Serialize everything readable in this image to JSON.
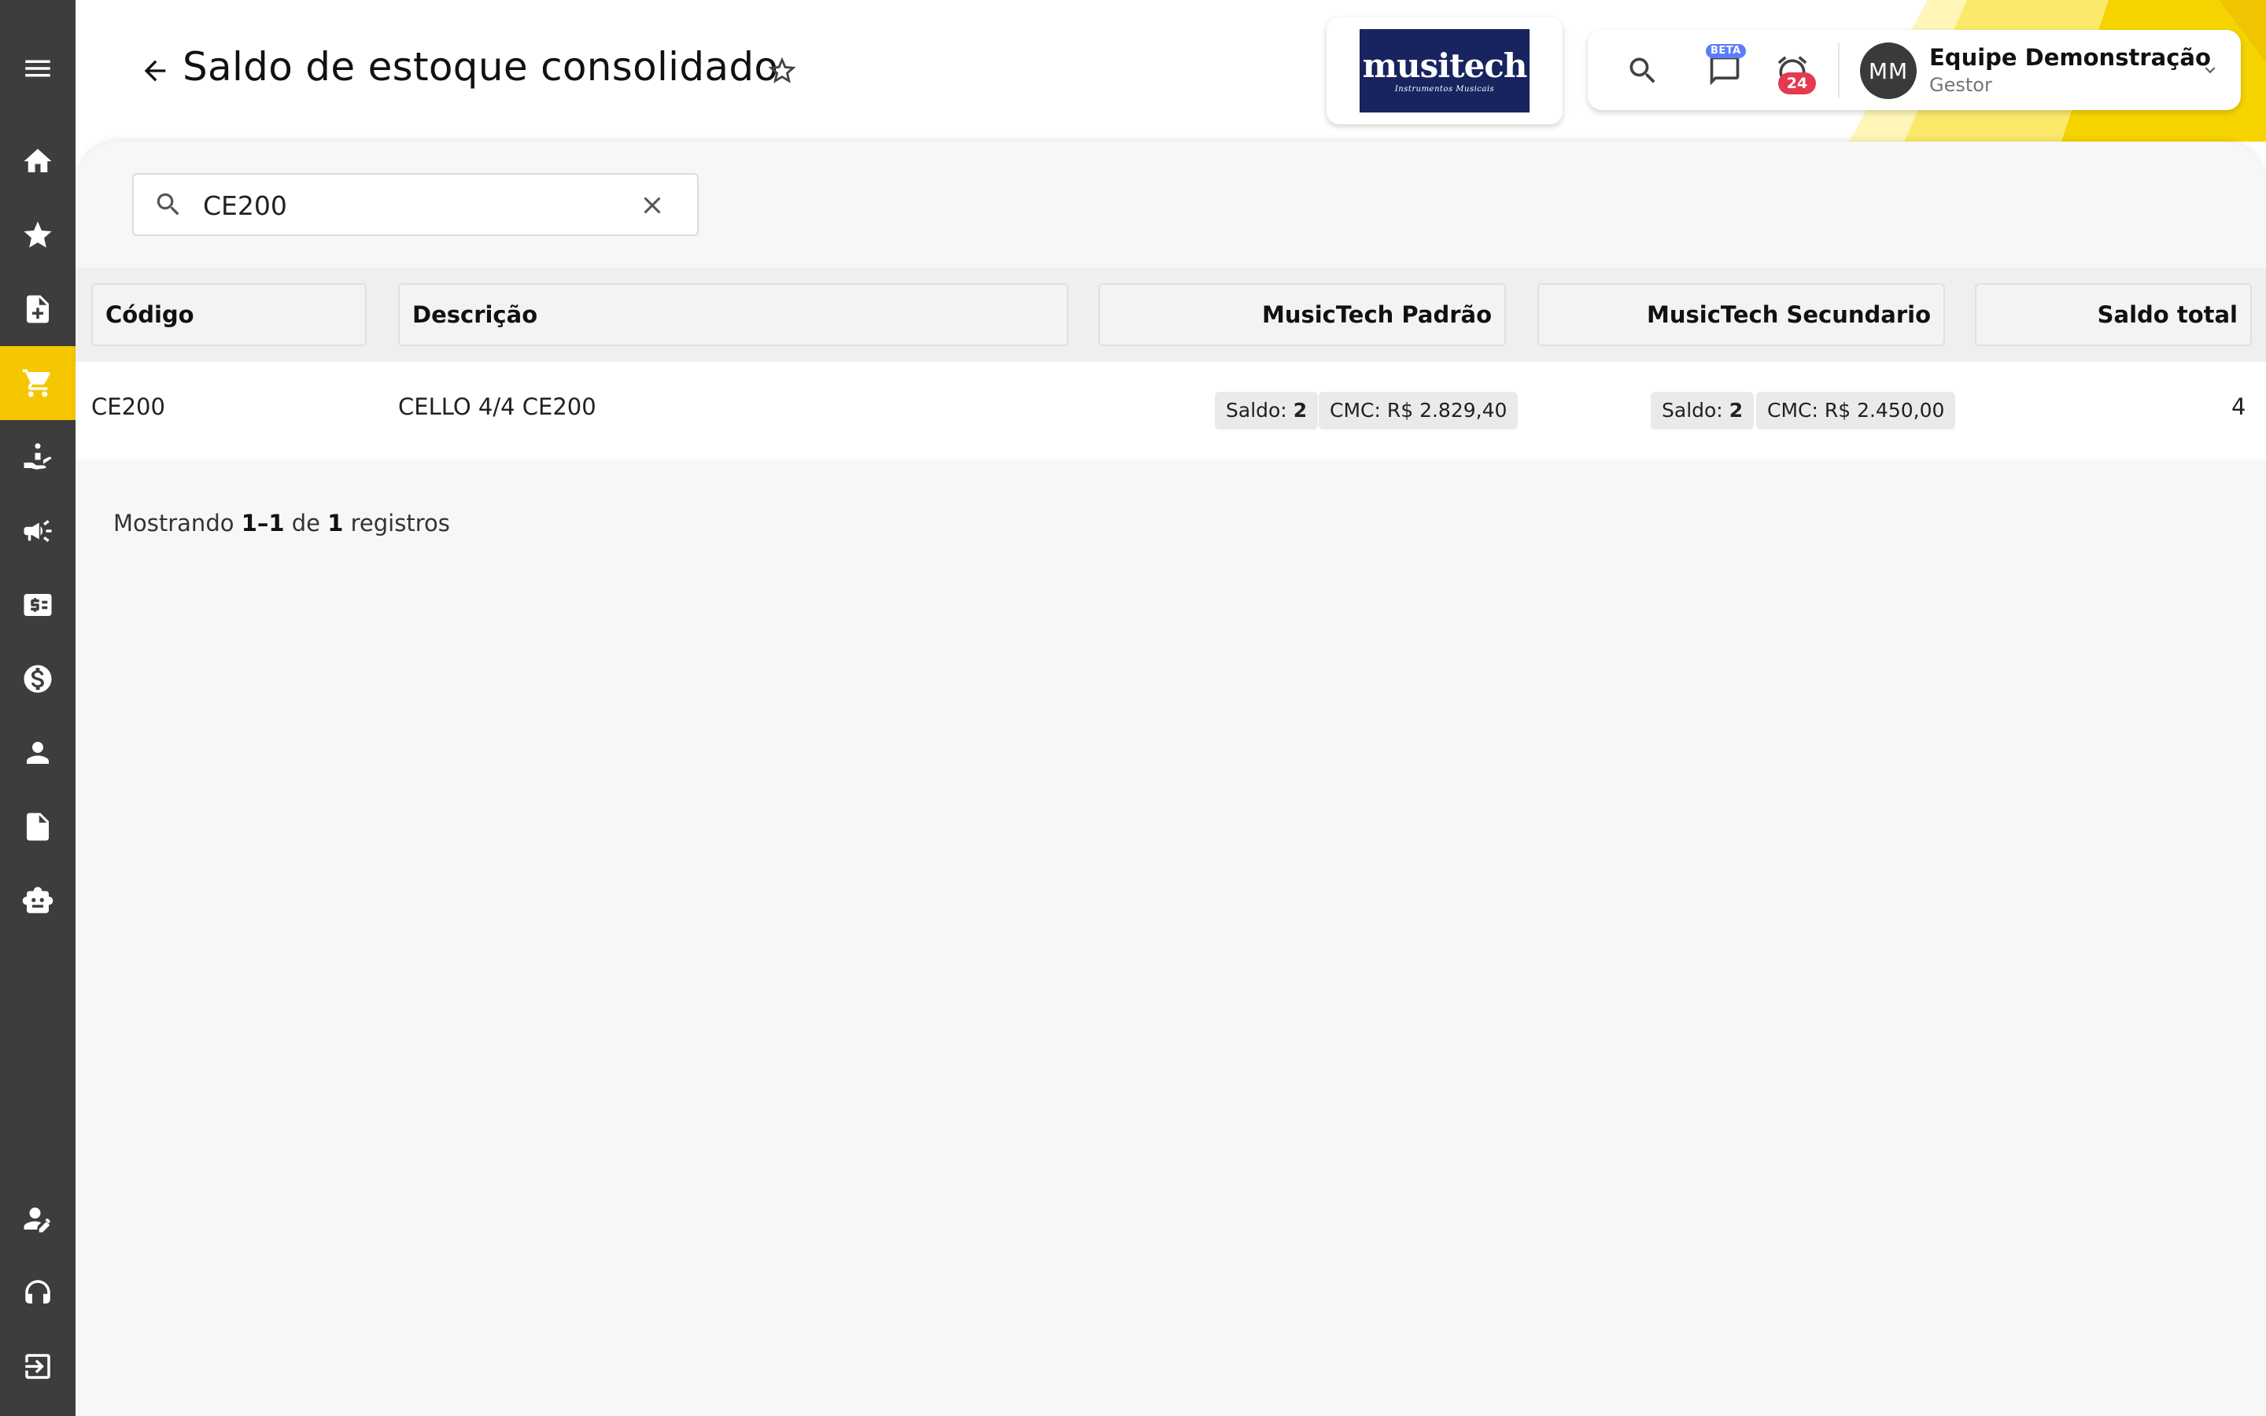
{
  "app": {
    "page_title": "Saldo de estoque consolidado",
    "accent_color": "#f6c700"
  },
  "sidebar": {
    "items": [
      {
        "name": "menu",
        "icon": "menu-icon",
        "active": false
      },
      {
        "name": "home",
        "icon": "home-icon",
        "active": false
      },
      {
        "name": "favorites",
        "icon": "star-icon",
        "active": false
      },
      {
        "name": "new-document",
        "icon": "note-add-icon",
        "active": false
      },
      {
        "name": "shopping",
        "icon": "cart-icon",
        "active": true
      },
      {
        "name": "services",
        "icon": "hand-icon",
        "active": false
      },
      {
        "name": "marketing",
        "icon": "megaphone-icon",
        "active": false
      },
      {
        "name": "billing",
        "icon": "money-card-icon",
        "active": false
      },
      {
        "name": "finance",
        "icon": "dollar-icon",
        "active": false
      },
      {
        "name": "people",
        "icon": "person-icon",
        "active": false
      },
      {
        "name": "reports",
        "icon": "file-icon",
        "active": false
      },
      {
        "name": "automation",
        "icon": "robot-icon",
        "active": false
      },
      {
        "name": "profile-edit",
        "icon": "person-edit-icon",
        "active": false
      },
      {
        "name": "support",
        "icon": "headset-icon",
        "active": false
      },
      {
        "name": "logout",
        "icon": "logout-icon",
        "active": false
      }
    ]
  },
  "logo": {
    "name": "musitech",
    "subtitle": "Instrumentos Musicais",
    "background": "#18245f"
  },
  "toolbar": {
    "beta_label": "BETA",
    "notification_count": "24",
    "user_initials": "MM",
    "user_name": "Equipe Demonstração",
    "user_role": "Gestor"
  },
  "search": {
    "value": "CE200"
  },
  "table": {
    "columns": [
      "Código",
      "Descrição",
      "MusicTech Padrão",
      "MusicTech Secundario",
      "Saldo total"
    ],
    "rows": [
      {
        "codigo": "CE200",
        "descricao": "CELLO 4/4 CE200",
        "padrao_saldo_label": "Saldo:",
        "padrao_saldo": "2",
        "padrao_cmc": "CMC: R$ 2.829,40",
        "secundario_saldo_label": "Saldo:",
        "secundario_saldo": "2",
        "secundario_cmc": "CMC: R$ 2.450,00",
        "saldo_total": "4"
      }
    ]
  },
  "footer": {
    "prefix": "Mostrando",
    "range": "1–1",
    "of": "de",
    "total": "1",
    "suffix": "registros"
  }
}
